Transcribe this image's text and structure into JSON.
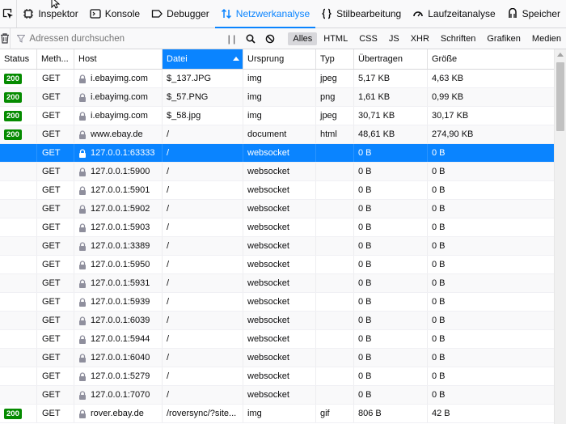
{
  "tabs": [
    {
      "label": "Inspektor",
      "icon": "inspector-icon"
    },
    {
      "label": "Konsole",
      "icon": "console-icon"
    },
    {
      "label": "Debugger",
      "icon": "debugger-icon"
    },
    {
      "label": "Netzwerkanalyse",
      "icon": "network-icon",
      "selected": true
    },
    {
      "label": "Stilbearbeitung",
      "icon": "style-editor-icon"
    },
    {
      "label": "Laufzeitanalyse",
      "icon": "performance-icon"
    },
    {
      "label": "Speicher",
      "icon": "memory-icon"
    }
  ],
  "toolbar": {
    "filter_placeholder": "Adressen durchsuchen",
    "pause_label": "| |",
    "type_filters": [
      "Alles",
      "HTML",
      "CSS",
      "JS",
      "XHR",
      "Schriften",
      "Grafiken",
      "Medien"
    ],
    "active_filter": "Alles"
  },
  "columns": {
    "status": "Status",
    "method": "Meth...",
    "host": "Host",
    "file": "Datei",
    "origin": "Ursprung",
    "type": "Typ",
    "transferred": "Übertragen",
    "size": "Größe"
  },
  "rows": [
    {
      "status": "200",
      "method": "GET",
      "host": "i.ebayimg.com",
      "file": "$_137.JPG",
      "origin": "img",
      "type": "jpeg",
      "transferred": "5,17 KB",
      "size": "4,63 KB"
    },
    {
      "status": "200",
      "method": "GET",
      "host": "i.ebayimg.com",
      "file": "$_57.PNG",
      "origin": "img",
      "type": "png",
      "transferred": "1,61 KB",
      "size": "0,99 KB"
    },
    {
      "status": "200",
      "method": "GET",
      "host": "i.ebayimg.com",
      "file": "$_58.jpg",
      "origin": "img",
      "type": "jpeg",
      "transferred": "30,71 KB",
      "size": "30,17 KB"
    },
    {
      "status": "200",
      "method": "GET",
      "host": "www.ebay.de",
      "file": "/",
      "origin": "document",
      "type": "html",
      "transferred": "48,61 KB",
      "size": "274,90 KB"
    },
    {
      "status": "",
      "method": "GET",
      "host": "127.0.0.1:63333",
      "file": "/",
      "origin": "websocket",
      "type": "",
      "transferred": "0 B",
      "size": "0 B",
      "selected": true
    },
    {
      "status": "",
      "method": "GET",
      "host": "127.0.0.1:5900",
      "file": "/",
      "origin": "websocket",
      "type": "",
      "transferred": "0 B",
      "size": "0 B"
    },
    {
      "status": "",
      "method": "GET",
      "host": "127.0.0.1:5901",
      "file": "/",
      "origin": "websocket",
      "type": "",
      "transferred": "0 B",
      "size": "0 B"
    },
    {
      "status": "",
      "method": "GET",
      "host": "127.0.0.1:5902",
      "file": "/",
      "origin": "websocket",
      "type": "",
      "transferred": "0 B",
      "size": "0 B"
    },
    {
      "status": "",
      "method": "GET",
      "host": "127.0.0.1:5903",
      "file": "/",
      "origin": "websocket",
      "type": "",
      "transferred": "0 B",
      "size": "0 B"
    },
    {
      "status": "",
      "method": "GET",
      "host": "127.0.0.1:3389",
      "file": "/",
      "origin": "websocket",
      "type": "",
      "transferred": "0 B",
      "size": "0 B"
    },
    {
      "status": "",
      "method": "GET",
      "host": "127.0.0.1:5950",
      "file": "/",
      "origin": "websocket",
      "type": "",
      "transferred": "0 B",
      "size": "0 B"
    },
    {
      "status": "",
      "method": "GET",
      "host": "127.0.0.1:5931",
      "file": "/",
      "origin": "websocket",
      "type": "",
      "transferred": "0 B",
      "size": "0 B"
    },
    {
      "status": "",
      "method": "GET",
      "host": "127.0.0.1:5939",
      "file": "/",
      "origin": "websocket",
      "type": "",
      "transferred": "0 B",
      "size": "0 B"
    },
    {
      "status": "",
      "method": "GET",
      "host": "127.0.0.1:6039",
      "file": "/",
      "origin": "websocket",
      "type": "",
      "transferred": "0 B",
      "size": "0 B"
    },
    {
      "status": "",
      "method": "GET",
      "host": "127.0.0.1:5944",
      "file": "/",
      "origin": "websocket",
      "type": "",
      "transferred": "0 B",
      "size": "0 B"
    },
    {
      "status": "",
      "method": "GET",
      "host": "127.0.0.1:6040",
      "file": "/",
      "origin": "websocket",
      "type": "",
      "transferred": "0 B",
      "size": "0 B"
    },
    {
      "status": "",
      "method": "GET",
      "host": "127.0.0.1:5279",
      "file": "/",
      "origin": "websocket",
      "type": "",
      "transferred": "0 B",
      "size": "0 B"
    },
    {
      "status": "",
      "method": "GET",
      "host": "127.0.0.1:7070",
      "file": "/",
      "origin": "websocket",
      "type": "",
      "transferred": "0 B",
      "size": "0 B"
    },
    {
      "status": "200",
      "method": "GET",
      "host": "rover.ebay.de",
      "file": "/roversync/?site...",
      "origin": "img",
      "type": "gif",
      "transferred": "806 B",
      "size": "42 B"
    }
  ],
  "colors": {
    "accent": "#0a84ff",
    "status_ok": "#058b00"
  }
}
